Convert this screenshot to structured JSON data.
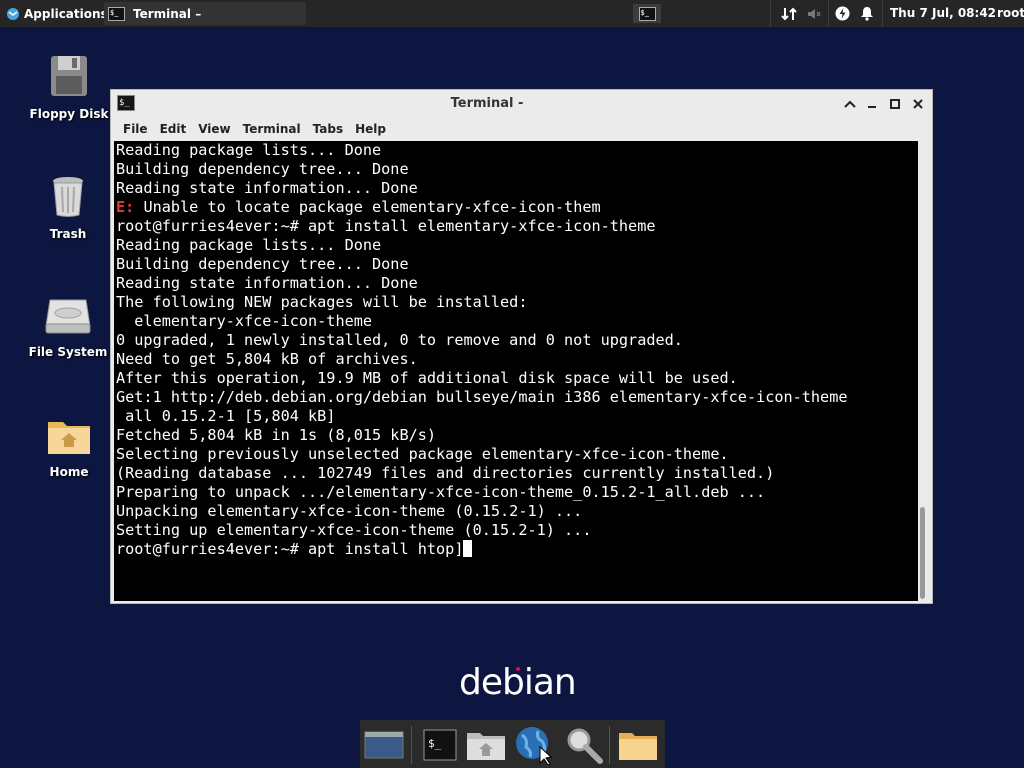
{
  "top_panel": {
    "applications_label": "Applications",
    "task_label": "Terminal –",
    "clock": "Thu 7 Jul, 08:42",
    "user": "root"
  },
  "desktop_icons": [
    {
      "label": "Floppy Disk",
      "icon": "floppy-disk-icon"
    },
    {
      "label": "Trash",
      "icon": "trash-icon"
    },
    {
      "label": "File System",
      "icon": "hard-drive-icon"
    },
    {
      "label": "Home",
      "icon": "home-folder-icon"
    }
  ],
  "window": {
    "title": "Terminal -",
    "menu": [
      "File",
      "Edit",
      "View",
      "Terminal",
      "Tabs",
      "Help"
    ]
  },
  "terminal": {
    "lines": [
      "Reading package lists... Done",
      "Building dependency tree... Done",
      "Reading state information... Done",
      "E: Unable to locate package elementary-xfce-icon-them",
      "root@furries4ever:~# apt install elementary-xfce-icon-theme",
      "Reading package lists... Done",
      "Building dependency tree... Done",
      "Reading state information... Done",
      "The following NEW packages will be installed:",
      "  elementary-xfce-icon-theme",
      "0 upgraded, 1 newly installed, 0 to remove and 0 not upgraded.",
      "Need to get 5,804 kB of archives.",
      "After this operation, 19.9 MB of additional disk space will be used.",
      "Get:1 http://deb.debian.org/debian bullseye/main i386 elementary-xfce-icon-theme",
      " all 0.15.2-1 [5,804 kB]",
      "Fetched 5,804 kB in 1s (8,015 kB/s)",
      "Selecting previously unselected package elementary-xfce-icon-theme.",
      "(Reading database ... 102749 files and directories currently installed.)",
      "Preparing to unpack .../elementary-xfce-icon-theme_0.15.2-1_all.deb ...",
      "Unpacking elementary-xfce-icon-theme (0.15.2-1) ...",
      "Setting up elementary-xfce-icon-theme (0.15.2-1) ...",
      "root@furries4ever:~# apt install htop]"
    ]
  },
  "logo_text": "debian",
  "dock_items": [
    "show-desktop-icon",
    "terminal-icon",
    "file-manager-icon",
    "web-browser-icon",
    "search-icon",
    "folder-icon"
  ],
  "colors": {
    "desktop_bg": "#0c1640",
    "panel_bg": "#262626",
    "error_red": "#e03a3a",
    "debian_red": "#d70a53"
  }
}
